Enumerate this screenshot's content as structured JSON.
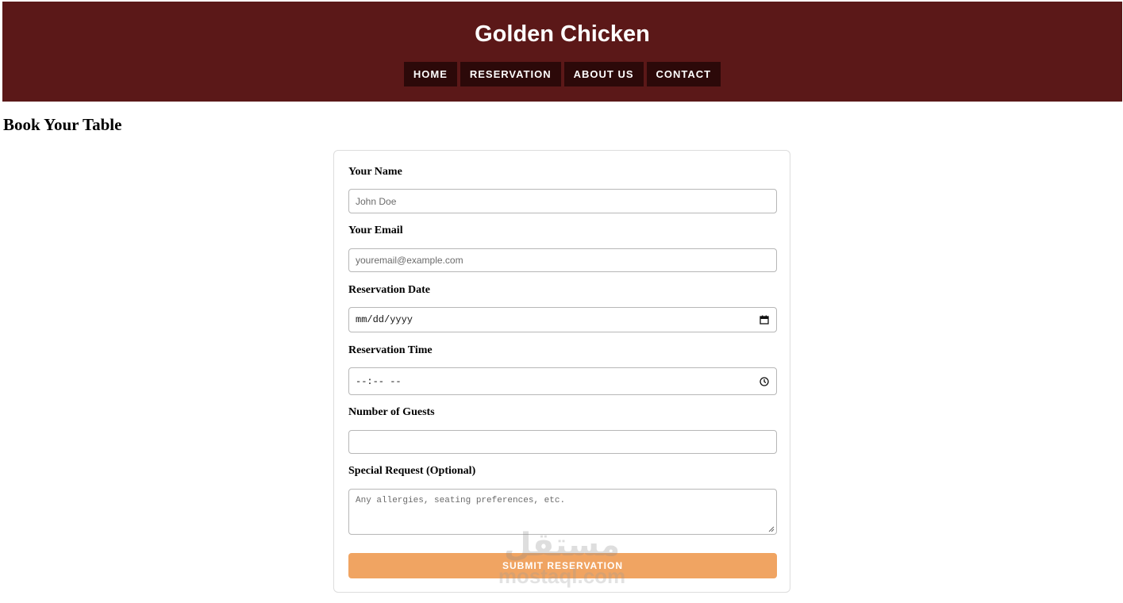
{
  "site": {
    "title": "Golden Chicken"
  },
  "nav": {
    "items": [
      {
        "label": "HOME"
      },
      {
        "label": "RESERVATION"
      },
      {
        "label": "ABOUT US"
      },
      {
        "label": "CONTACT"
      }
    ]
  },
  "page": {
    "heading": "Book Your Table"
  },
  "form": {
    "name": {
      "label": "Your Name",
      "placeholder": "John Doe",
      "value": ""
    },
    "email": {
      "label": "Your Email",
      "placeholder": "youremail@example.com",
      "value": ""
    },
    "date": {
      "label": "Reservation Date",
      "display": "mm/dd/yyyy",
      "icon": "calendar-icon"
    },
    "time": {
      "label": "Reservation Time",
      "display": "--:-- --",
      "icon": "clock-icon"
    },
    "guests": {
      "label": "Number of Guests",
      "value": ""
    },
    "special": {
      "label": "Special Request (Optional)",
      "placeholder": "Any allergies, seating preferences, etc.",
      "value": ""
    },
    "submit_label": "SUBMIT RESERVATION"
  },
  "watermark": {
    "mark": "مستقل",
    "url": "mostaql.com"
  },
  "colors": {
    "header_bg": "#5b1818",
    "nav_bg": "#2c0909",
    "submit_bg": "#f0a462"
  }
}
